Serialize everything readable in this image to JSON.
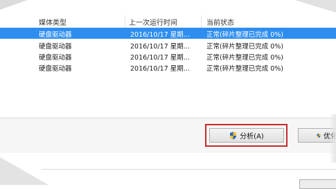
{
  "table": {
    "columns": [
      "媒体类型",
      "上一次运行时间",
      "当前状态"
    ],
    "rows": [
      {
        "media": "硬盘驱动器",
        "last_run": "2016/10/17 星期...",
        "status": "正常(碎片整理已完成 0%)",
        "selected": true
      },
      {
        "media": "硬盘驱动器",
        "last_run": "2016/10/17 星期...",
        "status": "正常(碎片整理已完成 0%)",
        "selected": false
      },
      {
        "media": "硬盘驱动器",
        "last_run": "2016/10/17 星期...",
        "status": "正常(碎片整理已完成 0%)",
        "selected": false
      },
      {
        "media": "硬盘驱动器",
        "last_run": "2016/10/17 星期...",
        "status": "正常(碎片整理已完成 0%)",
        "selected": false
      }
    ]
  },
  "buttons": {
    "analyze_label": "分析(A)",
    "optimize_label": "优化"
  },
  "colors": {
    "selection": "#2e8ef0",
    "highlight_frame": "#c62828",
    "shield_blue": "#2b63b8",
    "shield_yellow": "#f2c230"
  },
  "icons": {
    "analyze": "uac-shield-icon",
    "optimize": "uac-shield-icon"
  }
}
